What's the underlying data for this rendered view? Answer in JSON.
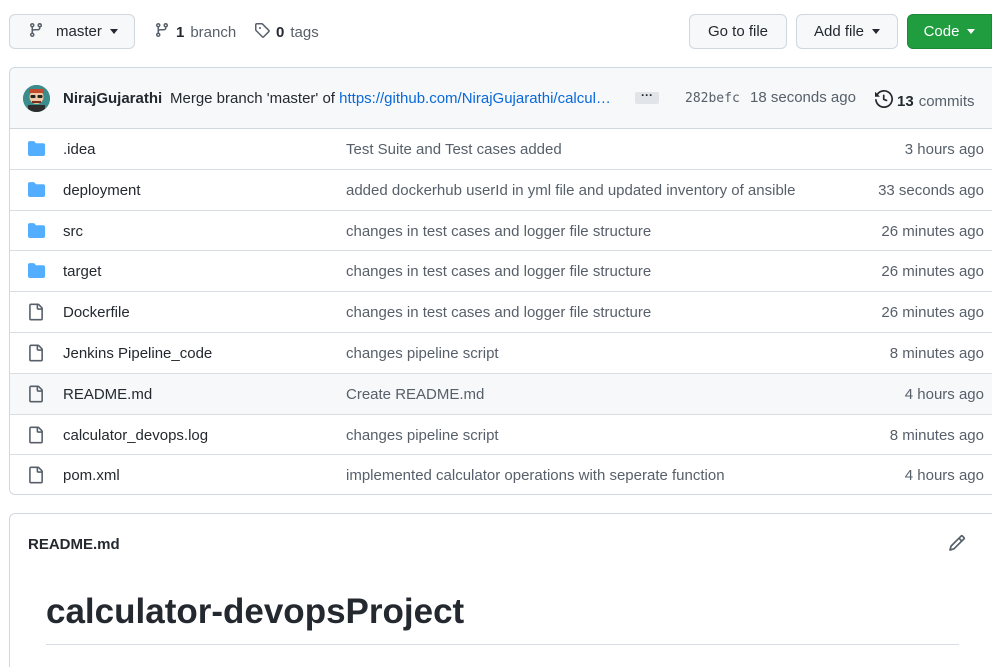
{
  "topbar": {
    "branch_selector": "master",
    "branch_count": "1",
    "branch_label": "branch",
    "tag_count": "0",
    "tag_label": "tags",
    "goto_file": "Go to file",
    "add_file": "Add file",
    "code": "Code"
  },
  "commit": {
    "author": "NirajGujarathi",
    "message_prefix": "Merge branch 'master' of",
    "message_link": "https://github.com/NirajGujarathi/calcul…",
    "ellipsis": "···",
    "sha": "282befc",
    "time": "18 seconds ago",
    "count": "13",
    "count_label": "commits"
  },
  "files": [
    {
      "type": "folder",
      "name": ".idea",
      "message": "Test Suite and Test cases added",
      "time": "3 hours ago"
    },
    {
      "type": "folder",
      "name": "deployment",
      "message": "added dockerhub userId in yml file and updated inventory of ansible",
      "time": "33 seconds ago"
    },
    {
      "type": "folder",
      "name": "src",
      "message": "changes in test cases and logger file structure",
      "time": "26 minutes ago"
    },
    {
      "type": "folder",
      "name": "target",
      "message": "changes in test cases and logger file structure",
      "time": "26 minutes ago"
    },
    {
      "type": "file",
      "name": "Dockerfile",
      "message": "changes in test cases and logger file structure",
      "time": "26 minutes ago"
    },
    {
      "type": "file",
      "name": "Jenkins Pipeline_code",
      "message": "changes pipeline script",
      "time": "8 minutes ago"
    },
    {
      "type": "file",
      "name": "README.md",
      "message": "Create README.md",
      "time": "4 hours ago"
    },
    {
      "type": "file",
      "name": "calculator_devops.log",
      "message": "changes pipeline script",
      "time": "8 minutes ago"
    },
    {
      "type": "file",
      "name": "pom.xml",
      "message": "implemented calculator operations with seperate function",
      "time": "4 hours ago"
    }
  ],
  "readme": {
    "header": "README.md",
    "title": "calculator-devopsProject"
  },
  "colors": {
    "folder_icon": "#54aeff",
    "primary_button": "#1f9d3f",
    "link": "#0969da"
  }
}
